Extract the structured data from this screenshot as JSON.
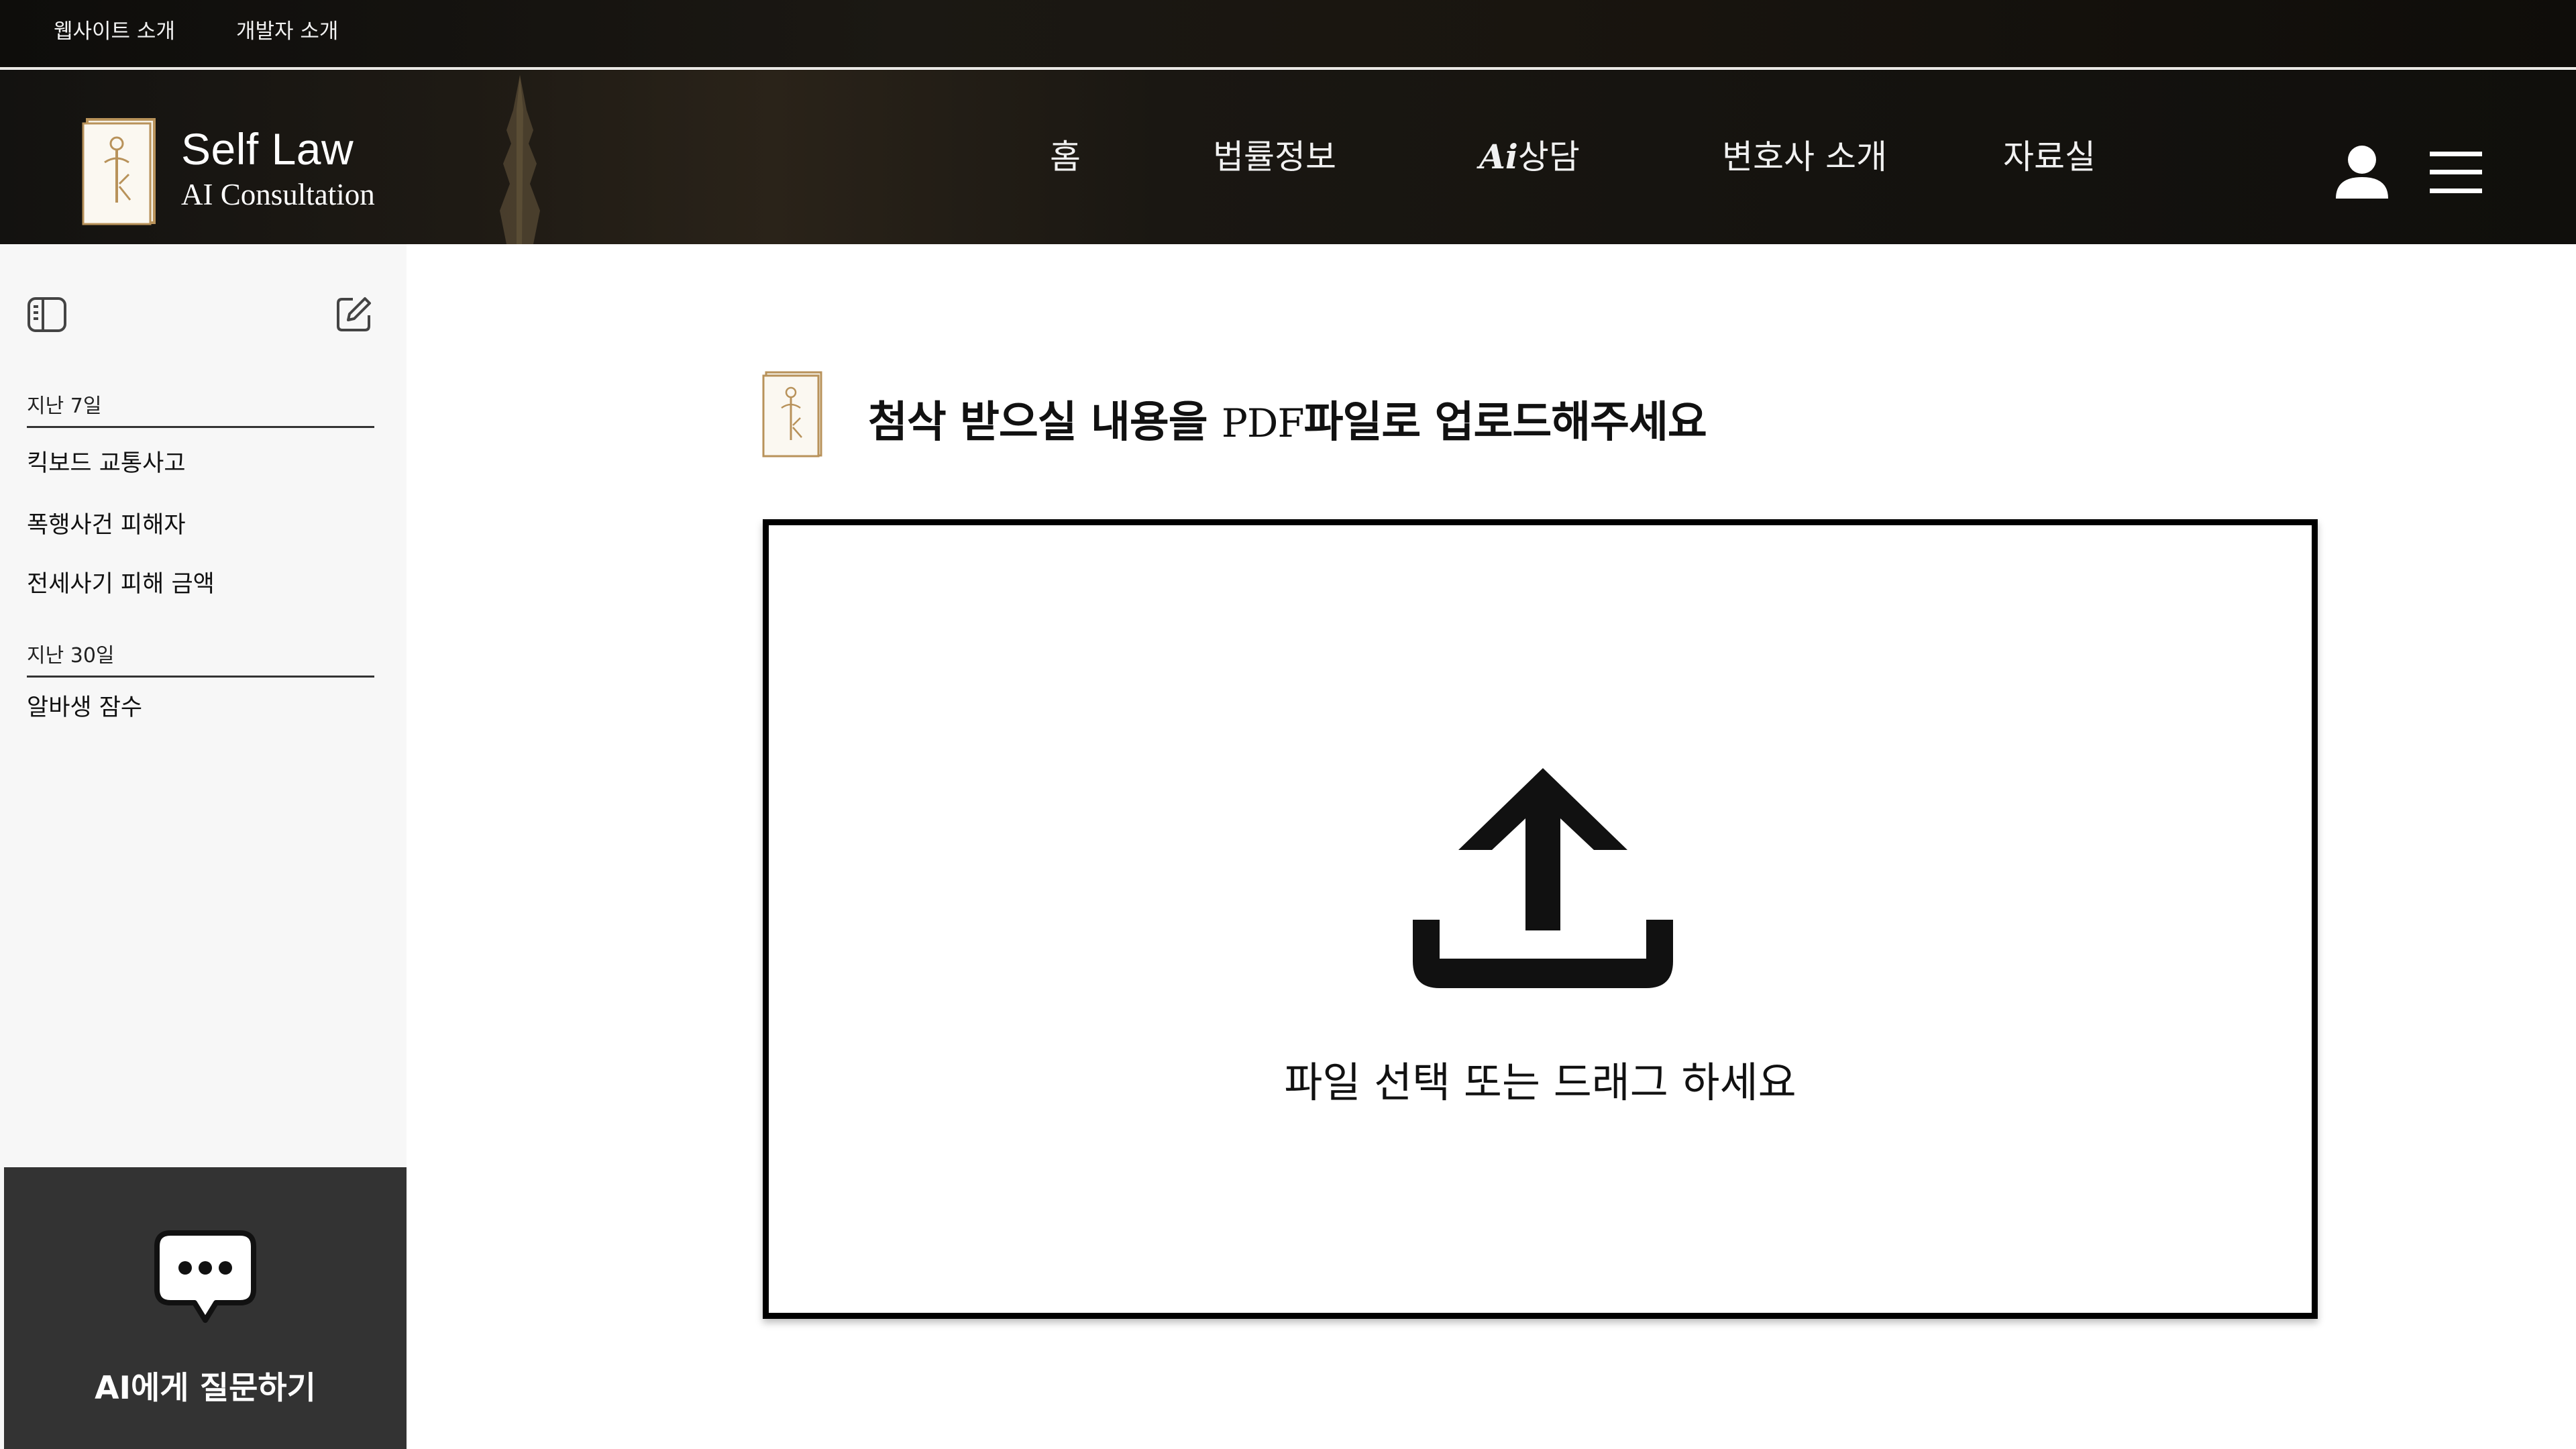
{
  "topbar": {
    "about_label": "웹사이트 소개",
    "developer_label": "개발자 소개"
  },
  "brand": {
    "title": "Self Law",
    "subtitle": "AI Consultation",
    "logo_icon": "law-book-logo-icon"
  },
  "nav": {
    "home": "홈",
    "legal_info": "법률정보",
    "ai_consult_mark": "Ai",
    "ai_consult_text": "상담",
    "lawyer_intro": "변호사 소개",
    "resources": "자료실"
  },
  "header_icons": {
    "user": "user-icon",
    "menu": "hamburger-menu-icon"
  },
  "sidebar": {
    "toggle_icon": "sidebar-toggle-icon",
    "new_chat_icon": "edit-icon",
    "groups": [
      {
        "label": "지난 7일",
        "items": [
          "킥보드 교통사고",
          "폭행사건 피해자",
          "전세사기 피해 금액"
        ]
      },
      {
        "label": "지난 30일",
        "items": [
          "알바생 잠수"
        ]
      }
    ],
    "ask_button_label": "AI에게 질문하기",
    "ask_icon": "chat-bubble-icon"
  },
  "main": {
    "title_prefix": "첨삭 받으실 내용을 ",
    "title_pdf": "PDF",
    "title_suffix": "파일로 업로드해주세요",
    "upload_icon": "upload-icon",
    "dropzone_text": "파일 선택 또는 드래그 하세요"
  },
  "colors": {
    "header_bg": "#15130f",
    "logo_gold": "#b8925a",
    "sidebar_bg": "#f7f7f7",
    "ask_panel_bg": "#333333"
  }
}
